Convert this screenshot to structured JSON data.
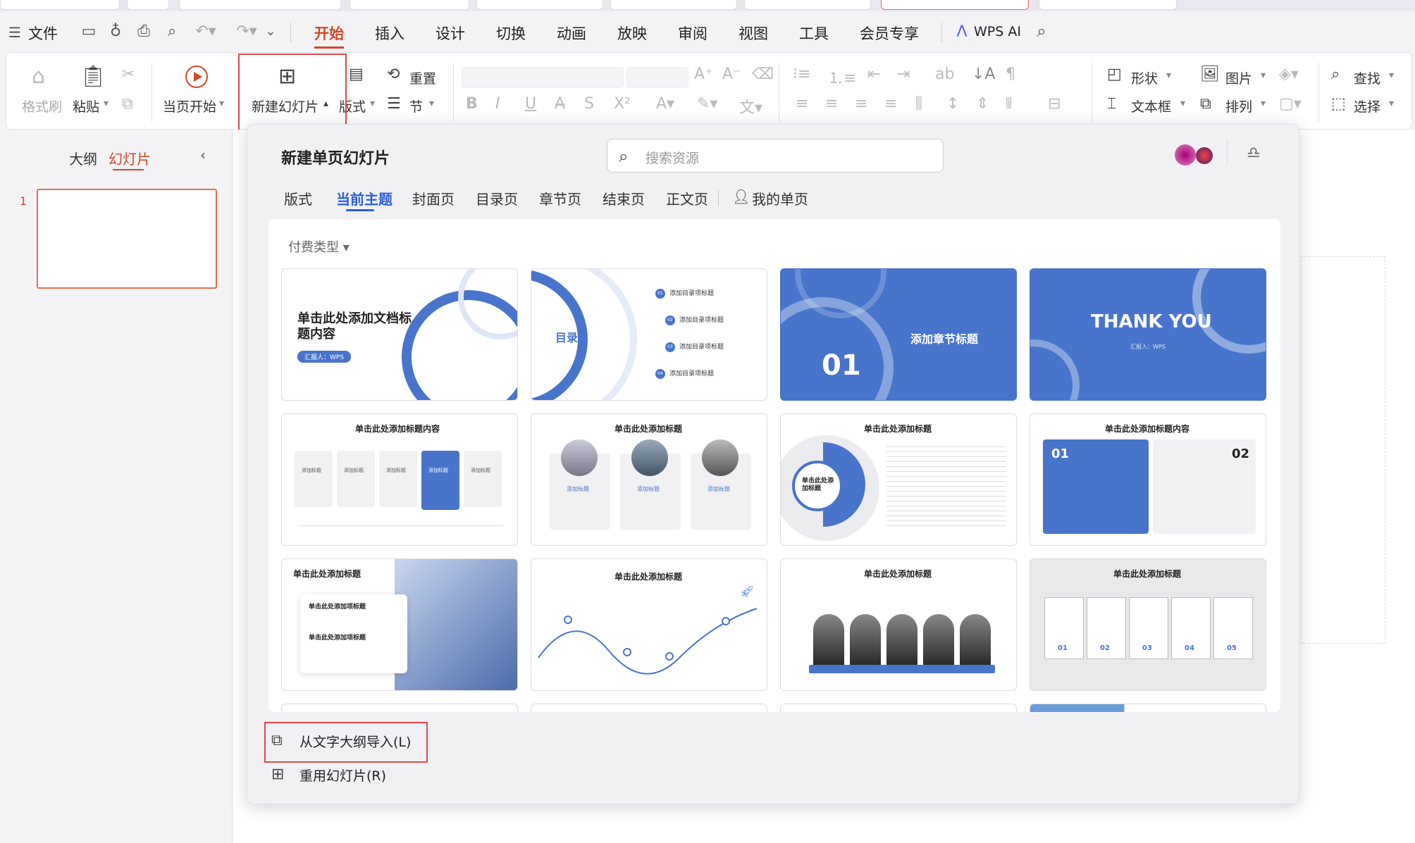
{
  "menubar": {
    "file": "文件",
    "tabs": [
      "开始",
      "插入",
      "设计",
      "切换",
      "动画",
      "放映",
      "审阅",
      "视图",
      "工具",
      "会员专享"
    ],
    "active_tab": "开始",
    "wps_ai": "WPS AI"
  },
  "ribbon": {
    "format_painter": "格式刷",
    "paste": "粘贴",
    "play_from_current": "当页开始",
    "new_slide": "新建幻灯片",
    "layout": "版式",
    "reset": "重置",
    "section": "节",
    "shape": "形状",
    "picture": "图片",
    "textbox": "文本框",
    "arrange": "排列",
    "find": "查找",
    "select": "选择"
  },
  "left_panel": {
    "tab_outline": "大纲",
    "tab_slides": "幻灯片",
    "slide_number": "1"
  },
  "popup": {
    "title": "新建单页幻灯片",
    "search_placeholder": "搜索资源",
    "tabs": [
      "版式",
      "当前主题",
      "封面页",
      "目录页",
      "章节页",
      "结束页",
      "正文页",
      "我的单页"
    ],
    "active_tab": "当前主题",
    "filter_label": "付费类型",
    "cards": {
      "c1_title": "单击此处添加文档标题内容",
      "c1_reporter": "汇报人：WPS",
      "c2_title": "目录",
      "c2_items": [
        "添加目录项标题",
        "添加目录项标题",
        "添加目录项标题",
        "添加目录项标题"
      ],
      "c2_nums": [
        "01",
        "02",
        "03",
        "04"
      ],
      "c3_num": "01",
      "c3_title": "添加章节标题",
      "c4_title": "THANK YOU",
      "c4_reporter": "汇报人：WPS",
      "c5_title": "单击此处添加标题内容",
      "c5_items": [
        "添加标题",
        "添加标题",
        "添加标题",
        "添加标题",
        "添加标题"
      ],
      "c6_title": "单击此处添加标题",
      "c6_items": [
        "添加标题",
        "添加标题",
        "添加标题"
      ],
      "c7_title": "单击此处添加标题",
      "c7_center": "单击此处添加标题",
      "c8_title": "单击此处添加标题内容",
      "c8_num1": "01",
      "c8_num2": "02",
      "c9_title": "单击此处添加标题",
      "c9_sub1": "单击此处添加项标题",
      "c9_sub2": "单击此处添加项标题",
      "c10_title": "单击此处添加标题",
      "c11_title": "单击此处添加标题",
      "c12_title": "单击此处添加标题",
      "c12_nums": [
        "01",
        "02",
        "03",
        "04",
        "05"
      ]
    },
    "import_outline": "从文字大纲导入(L)",
    "reuse_slides": "重用幻灯片(R)"
  },
  "colors": {
    "accent_orange": "#d24726",
    "theme_blue": "#4874cc",
    "highlight_red": "#e0474c",
    "tab_blue": "#2b5fd9"
  }
}
